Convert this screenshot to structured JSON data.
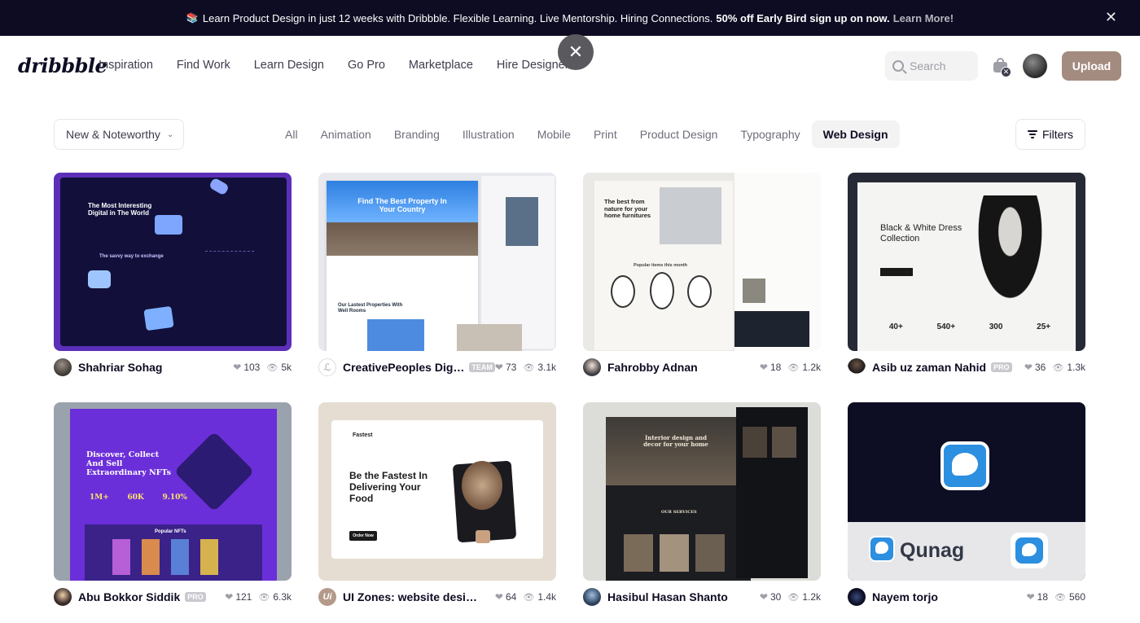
{
  "banner": {
    "icon": "book-icon",
    "text": "Learn Product Design in just 12 weeks with Dribbble. Flexible Learning. Live Mentorship. Hiring Connections.",
    "highlight": "50% off Early Bird sign up on now.",
    "link": "Learn More!"
  },
  "nav": {
    "logo": "dribbble",
    "links": [
      "Inspiration",
      "Find Work",
      "Learn Design",
      "Go Pro",
      "Marketplace",
      "Hire Designers"
    ],
    "search_placeholder": "Search",
    "upload": "Upload"
  },
  "filters": {
    "sort": "New & Noteworthy",
    "categories": [
      "All",
      "Animation",
      "Branding",
      "Illustration",
      "Mobile",
      "Print",
      "Product Design",
      "Typography",
      "Web Design"
    ],
    "active_category": "Web Design",
    "filters_label": "Filters"
  },
  "shots": [
    {
      "author": "Shahriar Sohag",
      "badge": "",
      "likes": "103",
      "views": "5k",
      "art": {
        "headline": "The Most Interesting Digital in The World",
        "sub": "The savvy way to exchange"
      }
    },
    {
      "author": "CreativePeoples Digi...",
      "badge": "TEAM",
      "likes": "73",
      "views": "3.1k",
      "art": {
        "headline": "Find The Best Property In Your Country",
        "sub": "Our Lastest Properties With Well Rooms"
      }
    },
    {
      "author": "Fahrobby Adnan",
      "badge": "",
      "likes": "18",
      "views": "1.2k",
      "art": {
        "headline": "The best from nature for your home furnitures",
        "sub": "Popular items this month"
      }
    },
    {
      "author": "Asib uz zaman Nahid",
      "badge": "PRO",
      "likes": "36",
      "views": "1.3k",
      "art": {
        "headline": "Black & White Dress Collection",
        "stats": [
          "40+",
          "540+",
          "300",
          "25+"
        ]
      }
    },
    {
      "author": "Abu Bokkor Siddik",
      "badge": "PRO",
      "likes": "121",
      "views": "6.3k",
      "art": {
        "headline": "Discover, Collect And Sell Extraordinary NFTs",
        "stats": [
          "1M+",
          "60K",
          "9.10%"
        ],
        "sub": "Popular NFTs"
      }
    },
    {
      "author": "UI Zones: website design",
      "badge": "",
      "likes": "64",
      "views": "1.4k",
      "art": {
        "brand": "Fastest",
        "headline": "Be the Fastest In Delivering Your Food",
        "cta": "Order Now"
      }
    },
    {
      "author": "Hasibul Hasan Shanto",
      "badge": "",
      "likes": "30",
      "views": "1.2k",
      "art": {
        "headline": "Interior design and decor for your home",
        "sub": "OUR SERVICES"
      }
    },
    {
      "author": "Nayem torjo",
      "badge": "",
      "likes": "18",
      "views": "560",
      "art": {
        "brand": "Qunag"
      }
    }
  ]
}
